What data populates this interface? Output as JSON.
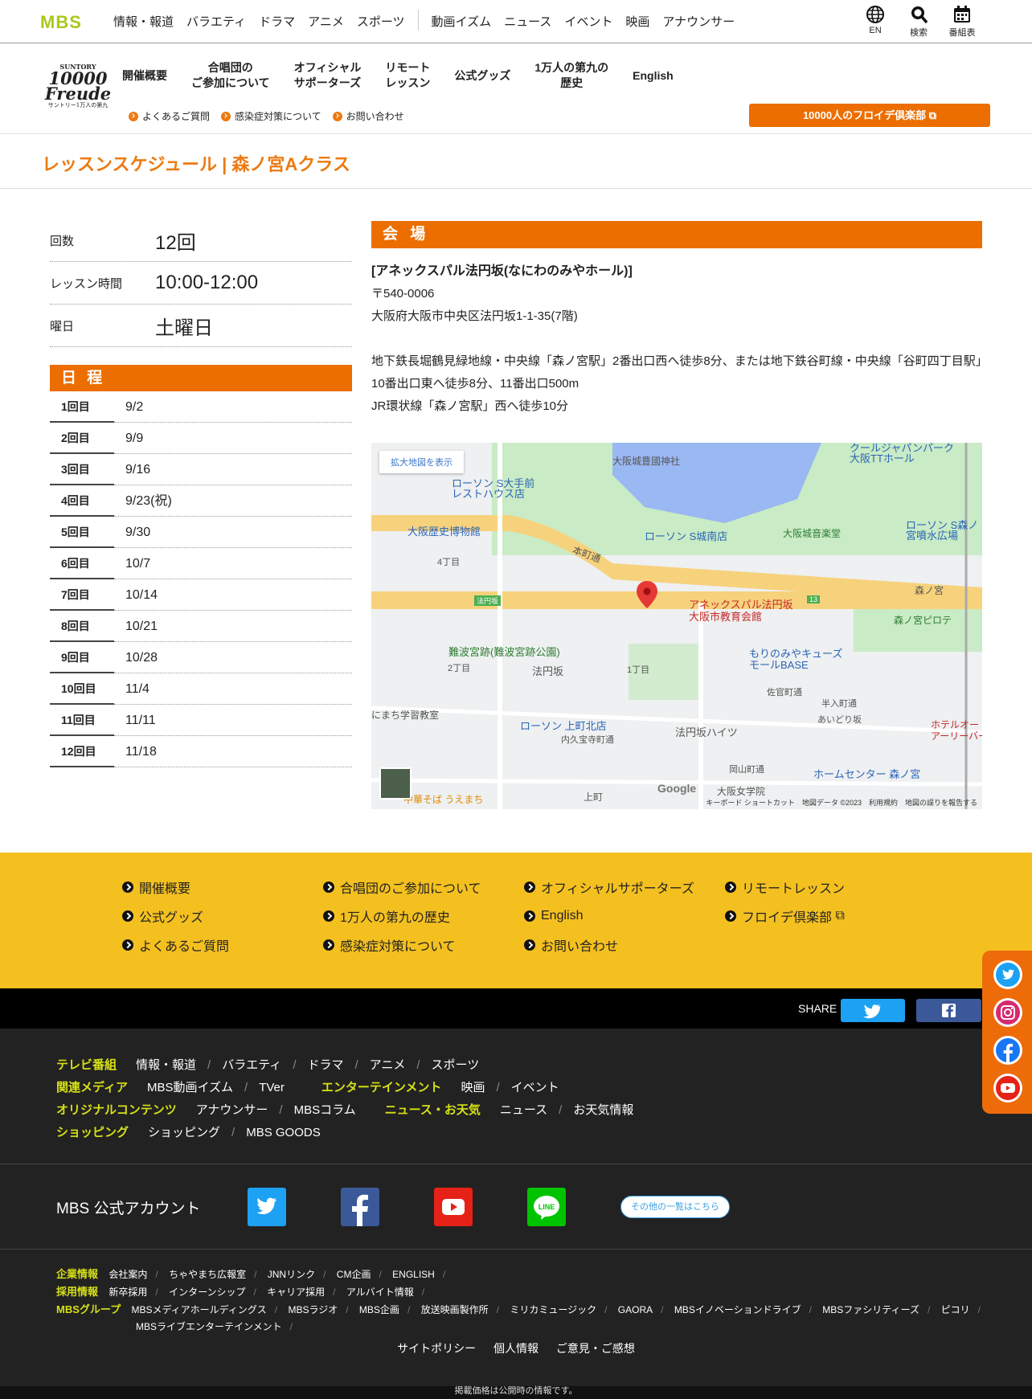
{
  "topnav": {
    "logo": "MBS",
    "items": [
      "情報・報道",
      "バラエティ",
      "ドラマ",
      "アニメ",
      "スポーツ"
    ],
    "items2": [
      "動画イズム",
      "ニュース",
      "イベント",
      "映画",
      "アナウンサー"
    ],
    "icons": [
      {
        "label": "EN",
        "icon": "globe-icon"
      },
      {
        "label": "検索",
        "icon": "search-icon"
      },
      {
        "label": "番組表",
        "icon": "calendar-icon"
      }
    ]
  },
  "brand": {
    "suntory": "SUNTORY",
    "number": "10000",
    "word": "Freude",
    "jp": "サントリー1万人の第九"
  },
  "subnav": {
    "items": [
      "開催概要",
      "合唱団の\nご参加について",
      "オフィシャル\nサポーターズ",
      "リモート\nレッスン",
      "公式グッズ",
      "1万人の第九の\n歴史",
      "English"
    ],
    "links": [
      "よくあるご質問",
      "感染症対策について",
      "お問い合わせ"
    ],
    "club_button": "10000人のフロイデ倶楽部"
  },
  "page": {
    "title": "レッスンスケジュール | 森ノ宮Aクラス"
  },
  "info": [
    {
      "k": "回数",
      "v": "12回"
    },
    {
      "k": "レッスン時間",
      "v": "10:00-12:00"
    },
    {
      "k": "曜日",
      "v": "土曜日"
    }
  ],
  "schedule": {
    "heading": "日 程",
    "rows": [
      {
        "k": "1回目",
        "v": "9/2"
      },
      {
        "k": "2回目",
        "v": "9/9"
      },
      {
        "k": "3回目",
        "v": "9/16"
      },
      {
        "k": "4回目",
        "v": "9/23(祝)"
      },
      {
        "k": "5回目",
        "v": "9/30"
      },
      {
        "k": "6回目",
        "v": "10/7"
      },
      {
        "k": "7回目",
        "v": "10/14"
      },
      {
        "k": "8回目",
        "v": "10/21"
      },
      {
        "k": "9回目",
        "v": "10/28"
      },
      {
        "k": "10回目",
        "v": "11/4"
      },
      {
        "k": "11回目",
        "v": "11/11"
      },
      {
        "k": "12回目",
        "v": "11/18"
      }
    ]
  },
  "venue": {
    "heading": "会 場",
    "name": "[アネックスパル法円坂(なにわのみやホール)]",
    "zip": "〒540-0006",
    "address": "大阪府大阪市中央区法円坂1-1-35(7階)",
    "access1": "地下鉄長堀鶴見緑地線・中央線「森ノ宮駅」2番出口西へ徒歩8分、または地下鉄谷町線・中央線「谷町四丁目駅」10番出口東へ徒歩8分、11番出口500m",
    "access2": "JR環状線「森ノ宮駅」西へ徒歩10分"
  },
  "map": {
    "button": "拡大地図を表示",
    "labels": [
      "大阪城豊國神社",
      "ローソン S大手前\nレストハウス店",
      "大阪歴史博物館",
      "ローソン S城南店",
      "大阪城音楽堂",
      "ローソン S森ノ\n宮噴水広場",
      "クールジャパンパーク\n大阪TTホール",
      "アネックスパル法円坂\n大阪市教育会館",
      "難波宮跡(難波宮跡公園)",
      "もりのみやキューズ\nモールBASE",
      "ローソン 上町北店",
      "法円坂ハイツ",
      "ホームセンター 森ノ宮",
      "森ノ宮ピロテ",
      "法円坂",
      "本町通",
      "大阪女学院",
      "中華そば うえまち",
      "にまち学習教室",
      "ホテルオー\nアーリーバード",
      "森ノ宮",
      "4丁目",
      "2丁目",
      "1丁目",
      "内久宝寺町通",
      "上町",
      "岡山町通",
      "佐官町通",
      "半入町通",
      "あいどり坂"
    ],
    "footer": "キーボード ショートカット　地図データ ©2023　利用規約　地図の誤りを報告する",
    "google": "Google",
    "badge13": "13",
    "houenzaka_sign": "法円坂"
  },
  "yellow_links": [
    "開催概要",
    "合唱団のご参加について",
    "オフィシャルサポーターズ",
    "リモートレッスン",
    "公式グッズ",
    "1万人の第九の歴史",
    "English",
    "フロイデ倶楽部",
    "よくあるご質問",
    "感染症対策について",
    "お問い合わせ"
  ],
  "share": {
    "label": "SHARE"
  },
  "footer_nav": [
    {
      "h": "テレビ番組",
      "items": [
        "情報・報道",
        "バラエティ",
        "ドラマ",
        "アニメ",
        "スポーツ"
      ]
    },
    {
      "h": "関連メディア",
      "items": [
        "MBS動画イズム",
        "TVer"
      ],
      "h2": "エンターテインメント",
      "items2": [
        "映画",
        "イベント"
      ]
    },
    {
      "h": "オリジナルコンテンツ",
      "items": [
        "アナウンサー",
        "MBSコラム"
      ],
      "h2": "ニュース・お天気",
      "items2": [
        "ニュース",
        "お天気情報"
      ]
    },
    {
      "h": "ショッピング",
      "items": [
        "ショッピング",
        "MBS GOODS"
      ]
    }
  ],
  "official": {
    "label": "MBS 公式アカウント",
    "other": "その他の一覧はこちら"
  },
  "corp": [
    {
      "h": "企業情報",
      "items": [
        "会社案内",
        "ちゃやまち広報室",
        "JNNリンク",
        "CM企画",
        "ENGLISH"
      ]
    },
    {
      "h": "採用情報",
      "items": [
        "新卒採用",
        "インターンシップ",
        "キャリア採用",
        "アルバイト情報"
      ]
    },
    {
      "h": "MBSグループ",
      "items": [
        "MBSメディアホールディングス",
        "MBSラジオ",
        "MBS企画",
        "放送映画製作所",
        "ミリカミュージック",
        "GAORA",
        "MBSイノベーションドライブ",
        "MBSファシリティーズ",
        "ピコリ",
        "MBSライブエンターテインメント"
      ]
    }
  ],
  "bottom_links": [
    "サイトポリシー",
    "個人情報",
    "ご意見・ご感想"
  ],
  "tiny": "掲載価格は公開時の情報です。",
  "colors": {
    "orange": "#ec6e00",
    "yellow": "#f4c020",
    "mbs_green": "#a9c81e",
    "footer_heading": "#d6e016"
  }
}
